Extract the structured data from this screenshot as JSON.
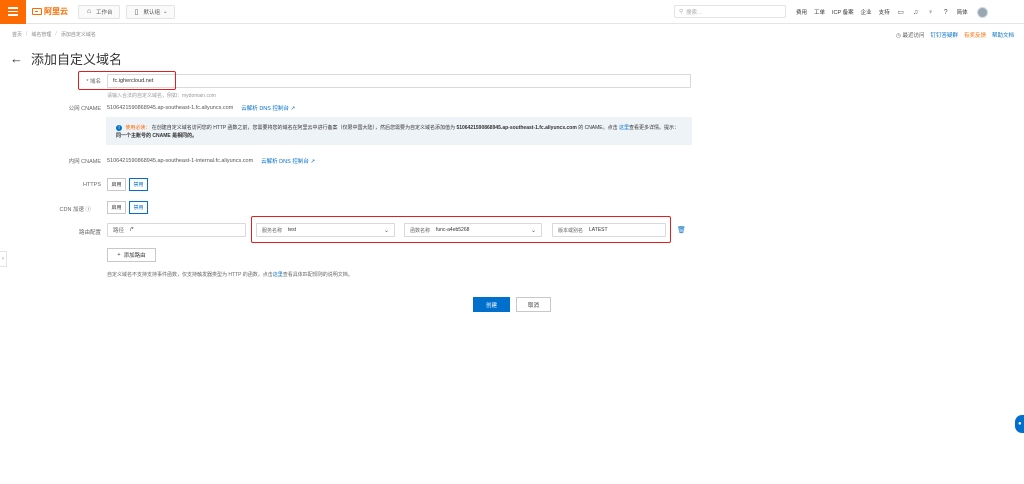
{
  "topbar": {
    "logo_text": "阿里云",
    "workbench": "工作台",
    "resource_group": "默认组",
    "search_placeholder": "搜索...",
    "links": [
      "费用",
      "工单",
      "ICP 备案",
      "企业",
      "支持"
    ],
    "lang": "简体"
  },
  "breadcrumb": [
    "首页",
    "域名管理",
    "添加自定义域名"
  ],
  "help_links": {
    "recent": "最近访问",
    "dingtalk": "钉钉答疑群",
    "feedback": "有奖反馈",
    "docs": "帮助文档"
  },
  "page": {
    "title": "添加自定义域名"
  },
  "form": {
    "domain": {
      "label": "* 域名",
      "value": "fc.ighercloud.net",
      "hint": "请输入合法的自定义域名，例如：mydomain.com"
    },
    "public_cname": {
      "label": "公网 CNAME",
      "value": "5106421590868945.ap-southeast-1.fc.aliyuncs.com",
      "link": "云解析 DNS 控制台"
    },
    "notice": {
      "title": "使用必读：",
      "text1": "在创建自定义域名访问您的 HTTP 函数之前，您需要将您的域名在阿里云中进行备案（仅限中国大陆），然后您需要为自定义域名添加值为",
      "bold_value": "5106421590868945.ap-southeast-1.fc.aliyuncs.com",
      "text2": "的 CNAME。点击",
      "link": "这里",
      "text3": "查看更多详情。提示：",
      "bold_tip": "同一个主账号的 CNAME 是相同的。"
    },
    "internal_cname": {
      "label": "内网 CNAME",
      "value": "5106421590868945.ap-southeast-1-internal.fc.aliyuncs.com",
      "link": "云解析 DNS 控制台"
    },
    "https": {
      "label": "HTTPS",
      "options": [
        "启用",
        "禁用"
      ],
      "selected": "禁用"
    },
    "cdn": {
      "label": "CDN 加速",
      "options": [
        "启用",
        "禁用"
      ],
      "selected": "禁用"
    },
    "route": {
      "label": "路由配置",
      "path_key": "路径",
      "path_value": "/*",
      "service_key": "服务名称",
      "service_value": "test",
      "function_key": "函数名称",
      "function_value": "func-a4eb5268",
      "version_key": "版本或别名",
      "version_value": "LATEST",
      "add_label": "添加路由"
    },
    "footnote_before": "自定义域名不支持支持事件函数，仅支持触发器类型为 HTTP 的函数，点击",
    "footnote_link": "这里",
    "footnote_after": "查看具体匹配规则的说明文档。"
  },
  "actions": {
    "create": "创建",
    "cancel": "取消"
  }
}
